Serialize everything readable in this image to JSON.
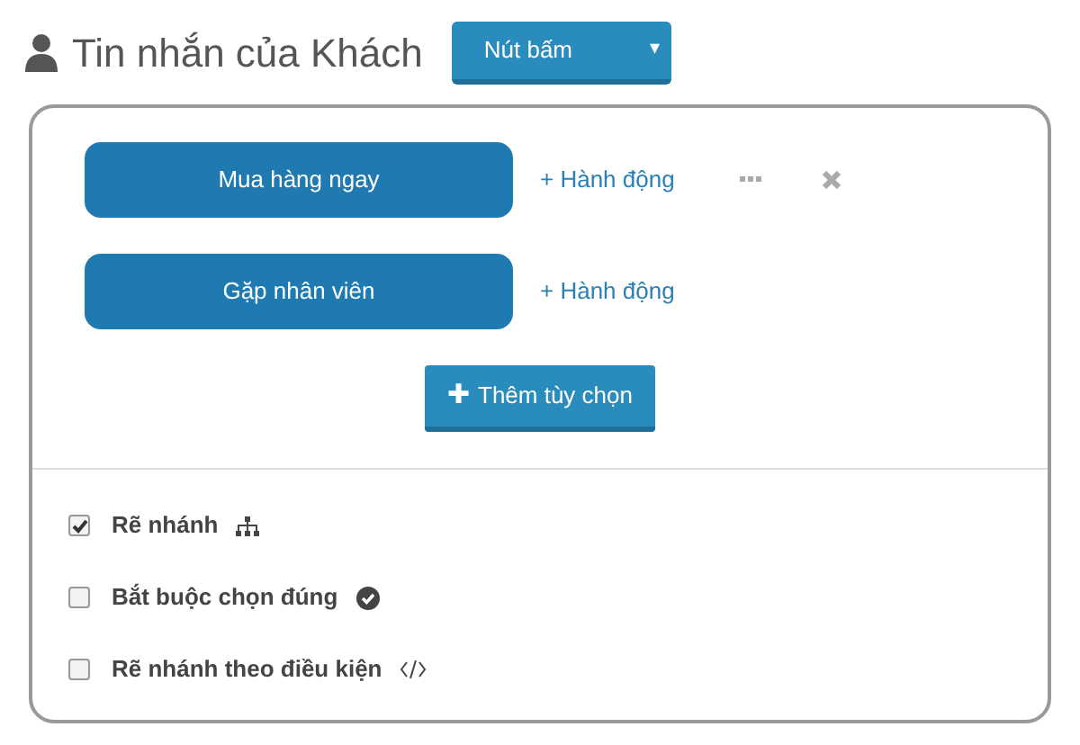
{
  "header": {
    "title": "Tin nhắn của Khách",
    "dropdown": {
      "label": "Nút bấm",
      "caret": "▾"
    }
  },
  "options": [
    {
      "label": "Mua hàng ngay",
      "action": "+ Hành động",
      "tools_visible": true
    },
    {
      "label": "Gặp nhân viên",
      "action": "+ Hành động",
      "tools_visible": false
    }
  ],
  "add_button": {
    "icon": "✚",
    "label": "Thêm tùy chọn"
  },
  "settings": [
    {
      "label": "Rẽ nhánh",
      "checked": true,
      "kind": "branch"
    },
    {
      "label": "Bắt buộc chọn đúng",
      "checked": false,
      "kind": "required"
    },
    {
      "label": "Rẽ nhánh theo điều kiện",
      "checked": false,
      "kind": "condition"
    }
  ]
}
